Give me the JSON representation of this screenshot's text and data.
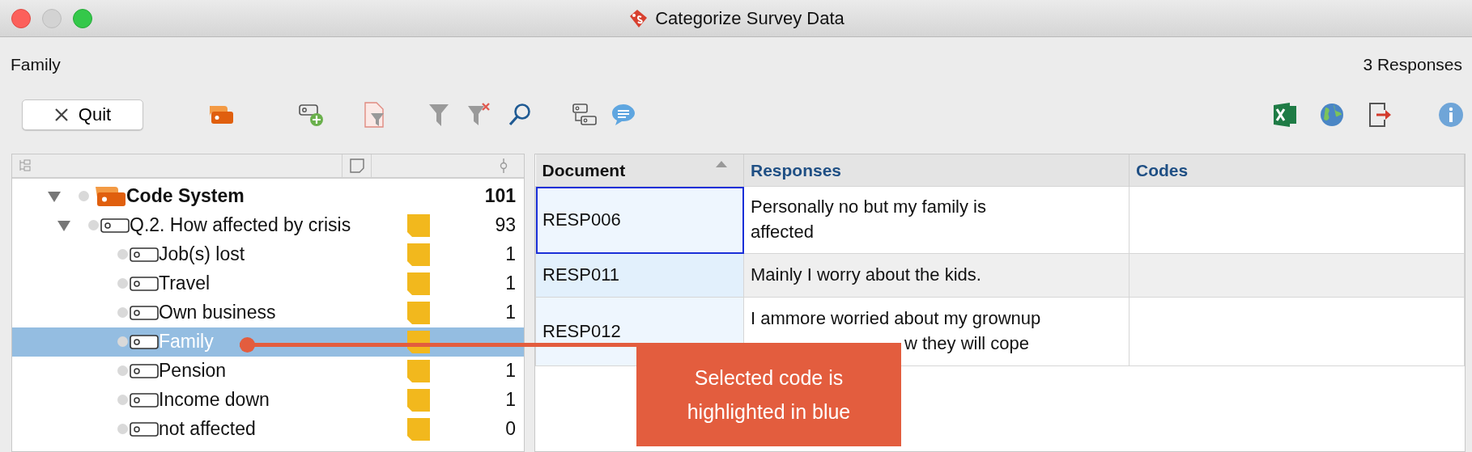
{
  "window": {
    "title": "Categorize Survey Data"
  },
  "header": {
    "selected_code": "Family",
    "response_count": "3 Responses"
  },
  "toolbar": {
    "quit_label": "Quit"
  },
  "tree": {
    "items": [
      {
        "label": "Code System",
        "count": "101",
        "kind": "root",
        "expanded": true,
        "selected": false,
        "children": [
          {
            "label": "Q.2. How affected by crisis",
            "count": "93",
            "kind": "code",
            "expanded": true,
            "selected": false,
            "children": [
              {
                "label": "Job(s) lost",
                "count": "1",
                "kind": "code",
                "selected": false
              },
              {
                "label": "Travel",
                "count": "1",
                "kind": "code",
                "selected": false
              },
              {
                "label": "Own business",
                "count": "1",
                "kind": "code",
                "selected": false
              },
              {
                "label": "Family",
                "kind": "code",
                "selected": true
              },
              {
                "label": "Pension",
                "count": "1",
                "kind": "code",
                "selected": false
              },
              {
                "label": "Income down",
                "count": "1",
                "kind": "code",
                "selected": false
              },
              {
                "label": "not affected",
                "count": "0",
                "kind": "code",
                "selected": false
              }
            ]
          }
        ]
      }
    ]
  },
  "table": {
    "columns": [
      {
        "label": "Document",
        "sorted": true
      },
      {
        "label": "Responses",
        "sorted": false
      },
      {
        "label": "Codes",
        "sorted": false
      }
    ],
    "rows": [
      {
        "document": "RESP006",
        "response": "Personally no but my family is affected",
        "focused": true
      },
      {
        "document": "RESP011",
        "response": "Mainly I worry about the kids.",
        "focused": false
      },
      {
        "document": "RESP012",
        "response": "I ammore worried about my grownup",
        "response_continued": "w they will cope",
        "focused": false
      }
    ]
  },
  "callout": {
    "text": "Selected code is highlighted in blue"
  }
}
